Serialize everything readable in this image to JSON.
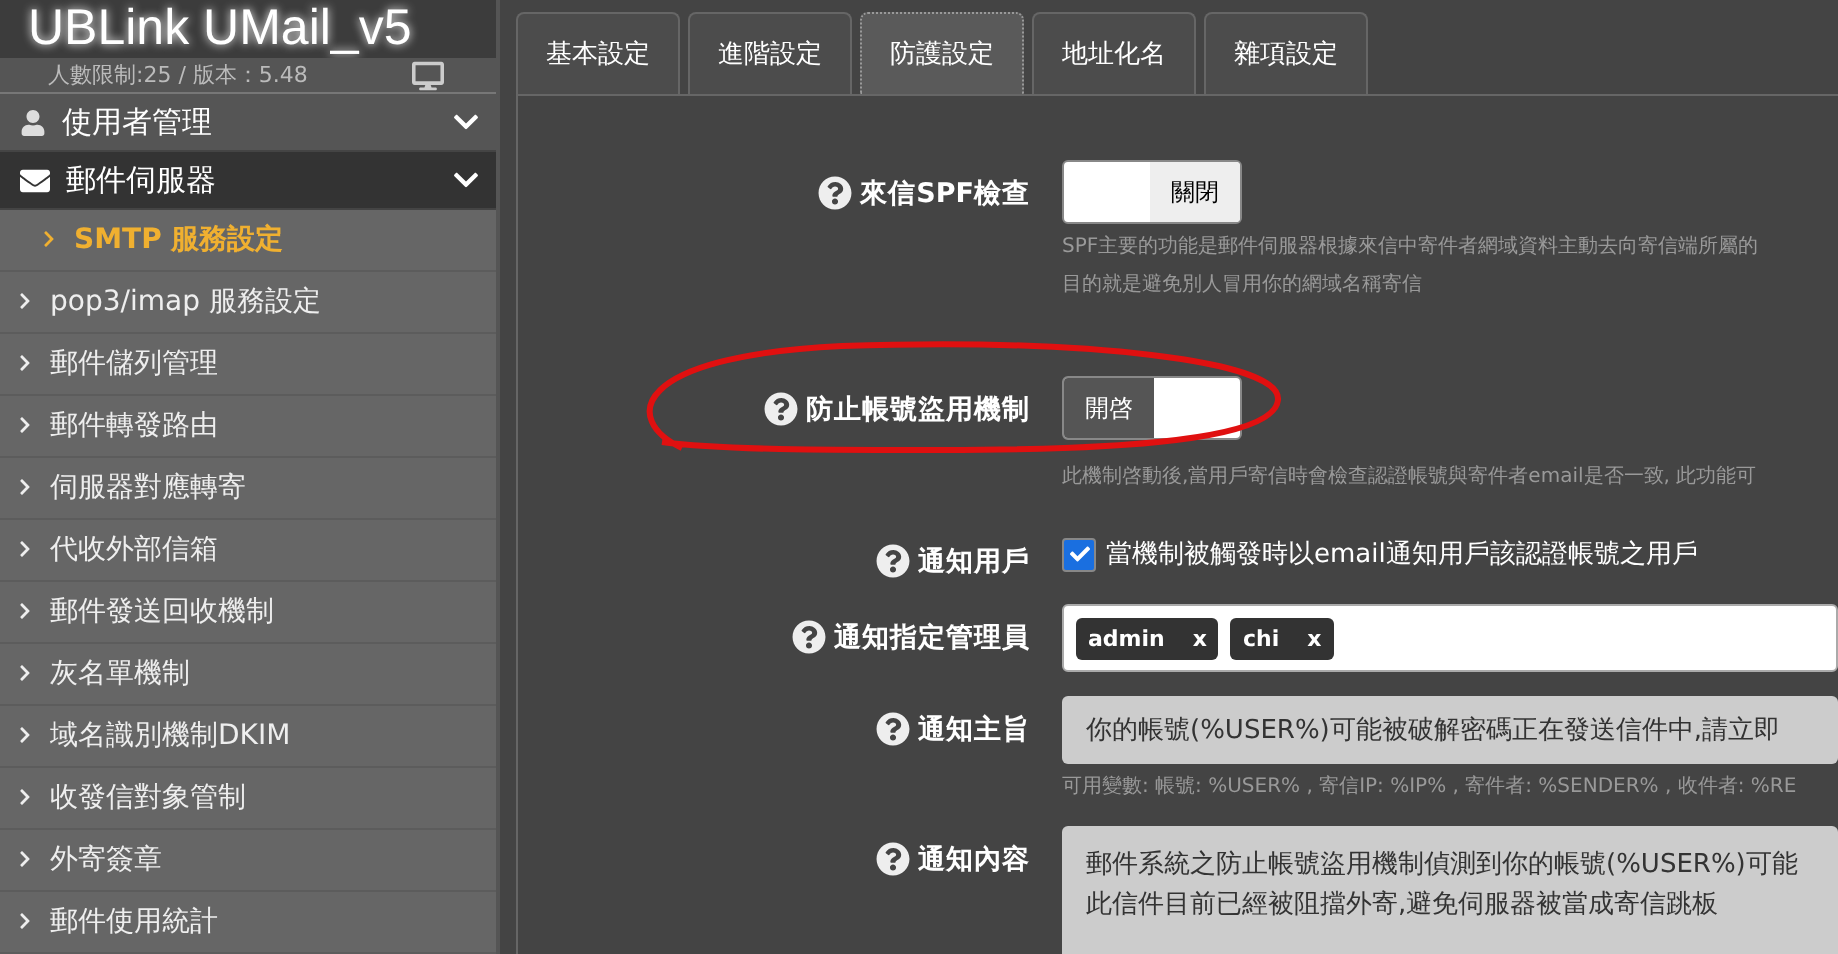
{
  "app": {
    "title": "UBLink UMail_v5",
    "info": "人數限制:25 / 版本：5.48"
  },
  "sidebar": {
    "groups": [
      {
        "label": "使用者管理",
        "selected": false
      },
      {
        "label": "郵件伺服器",
        "selected": true
      }
    ],
    "items": [
      {
        "label": "SMTP 服務設定",
        "selected": true
      },
      {
        "label": "pop3/imap 服務設定",
        "selected": false
      },
      {
        "label": "郵件儲列管理",
        "selected": false
      },
      {
        "label": "郵件轉發路由",
        "selected": false
      },
      {
        "label": "伺服器對應轉寄",
        "selected": false
      },
      {
        "label": "代收外部信箱",
        "selected": false
      },
      {
        "label": "郵件發送回收機制",
        "selected": false
      },
      {
        "label": "灰名單機制",
        "selected": false
      },
      {
        "label": "域名識別機制DKIM",
        "selected": false
      },
      {
        "label": "收發信對象管制",
        "selected": false
      },
      {
        "label": "外寄簽章",
        "selected": false
      },
      {
        "label": "郵件使用統計",
        "selected": false
      }
    ]
  },
  "tabs": [
    {
      "label": "基本設定",
      "selected": false
    },
    {
      "label": "進階設定",
      "selected": false
    },
    {
      "label": "防護設定",
      "selected": true
    },
    {
      "label": "地址化名",
      "selected": false
    },
    {
      "label": "雜項設定",
      "selected": false
    }
  ],
  "form": [
    {
      "kind": "toggle",
      "label": "來信SPF檢查",
      "on": false,
      "state_text": "關閉",
      "help": [
        "SPF主要的功能是郵件伺服器根據來信中寄件者網域資料主動去向寄信端所屬的",
        "目的就是避免別人冒用你的網域名稱寄信"
      ]
    },
    {
      "kind": "toggle",
      "label": "防止帳號盜用機制",
      "on": true,
      "state_text": "開啓",
      "help": [
        "此機制啓動後,當用戶寄信時會檢查認證帳號與寄件者email是否一致, 此功能可"
      ],
      "circled": true
    },
    {
      "kind": "checkbox",
      "label": "通知用戶",
      "checked": true,
      "text": "當機制被觸發時以email通知用戶該認證帳號之用戶"
    },
    {
      "kind": "tags",
      "label": "通知指定管理員",
      "tags": [
        {
          "label": "admin",
          "remove": "x"
        },
        {
          "label": "chi",
          "remove": "x"
        }
      ]
    },
    {
      "kind": "input",
      "label": "通知主旨",
      "value": "你的帳號(%USER%)可能被破解密碼正在發送信件中,請立即",
      "help": [
        "可用變數: 帳號: %USER% , 寄信IP: %IP% , 寄件者: %SENDER% , 收件者: %RE"
      ]
    },
    {
      "kind": "textarea",
      "label": "通知內容",
      "lines": [
        "郵件系統之防止帳號盜用機制偵測到你的帳號(%USER%)可能",
        "此信件目前已經被阻擋外寄,避免伺服器被當成寄信跳板"
      ]
    }
  ]
}
